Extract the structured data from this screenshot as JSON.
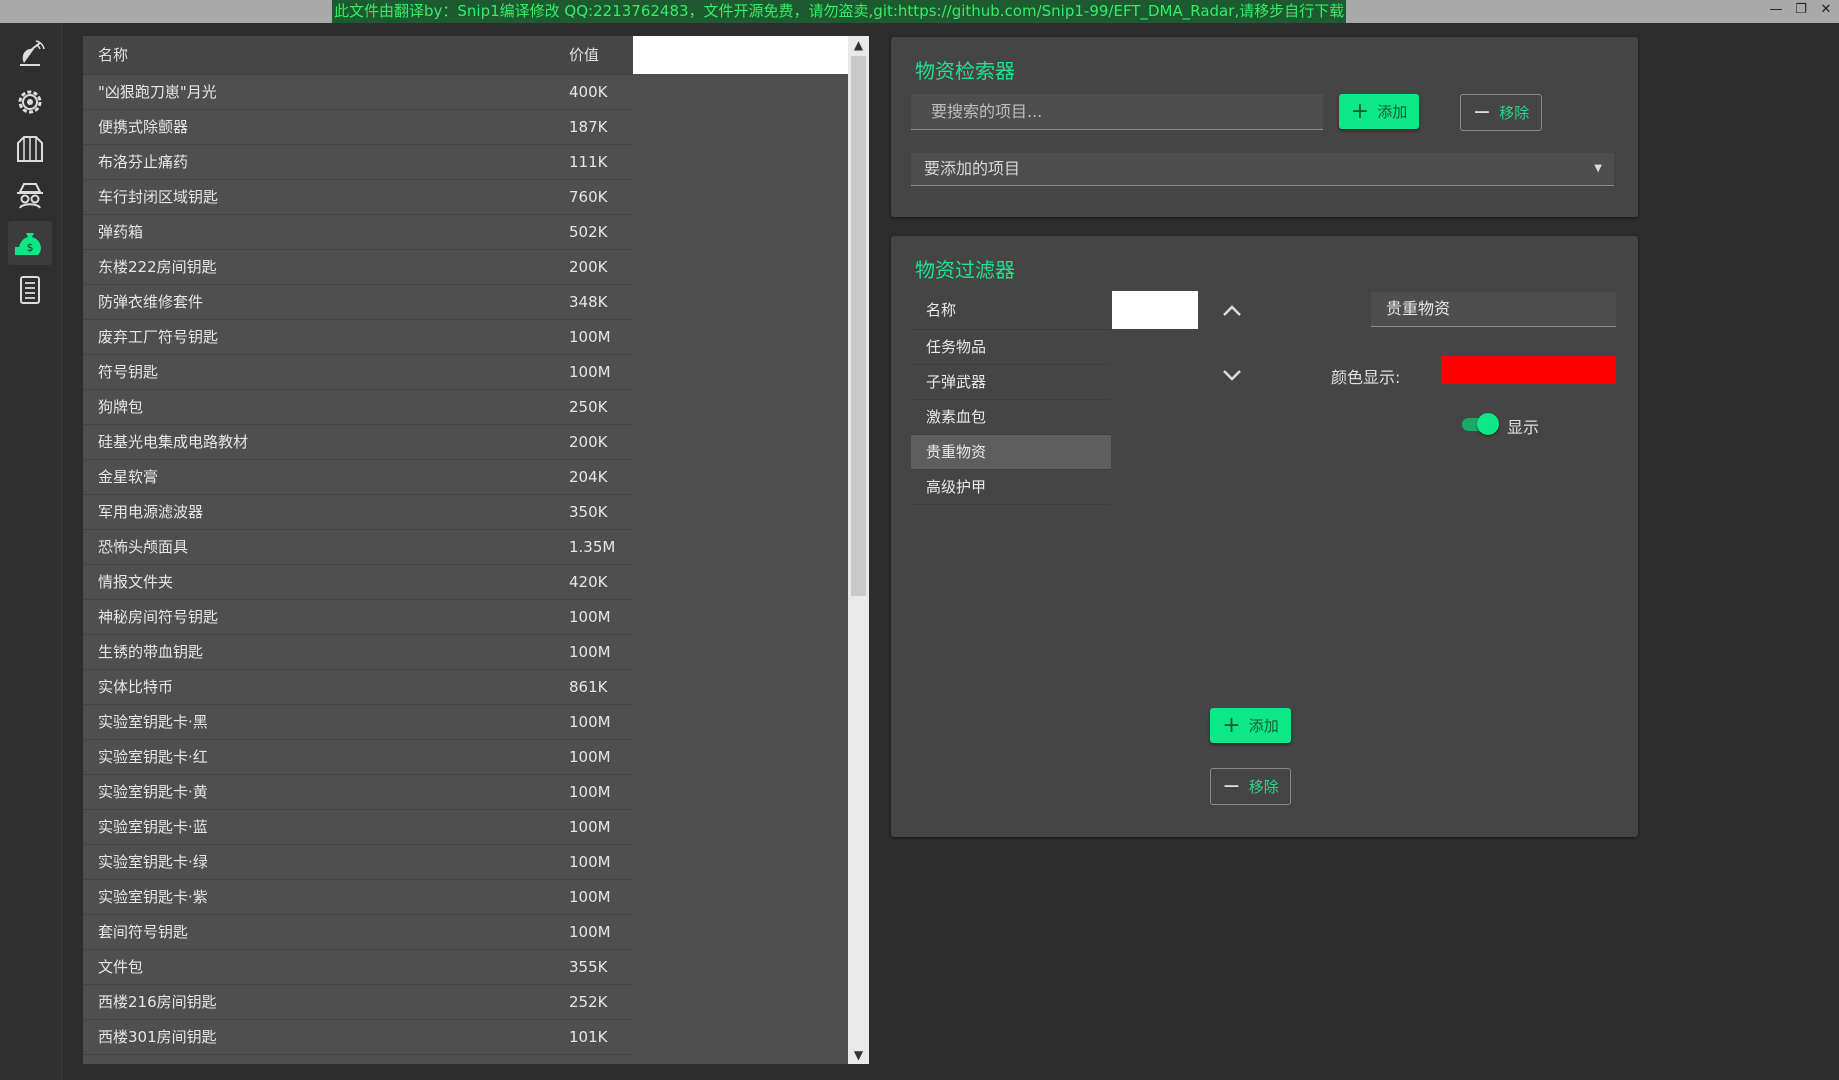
{
  "titlebar": {
    "banner": "此文件由翻译by：Snip1编译修改 QQ:2213762483，文件开源免费，请勿盗卖,git:https://github.com/Snip1-99/EFT_DMA_Radar,请移步自行下载",
    "minimize": "—",
    "restore": "❐",
    "close": "✕"
  },
  "sidebar": {
    "items": [
      {
        "icon": "radar-icon"
      },
      {
        "icon": "settings-gear-icon"
      },
      {
        "icon": "jacket-icon"
      },
      {
        "icon": "spy-icon"
      },
      {
        "icon": "money-bag-icon",
        "active": true
      },
      {
        "icon": "document-list-icon"
      }
    ]
  },
  "loot_table": {
    "headers": {
      "name": "名称",
      "value": "价值"
    },
    "rows": [
      {
        "name": "\"凶狠跑刀崽\"月光",
        "value": "400K"
      },
      {
        "name": "便携式除颤器",
        "value": "187K"
      },
      {
        "name": "布洛芬止痛药",
        "value": "111K"
      },
      {
        "name": "车行封闭区域钥匙",
        "value": "760K"
      },
      {
        "name": "弹药箱",
        "value": "502K"
      },
      {
        "name": "东楼222房间钥匙",
        "value": "200K"
      },
      {
        "name": "防弹衣维修套件",
        "value": "348K"
      },
      {
        "name": "废弃工厂符号钥匙",
        "value": "100M"
      },
      {
        "name": "符号钥匙",
        "value": "100M"
      },
      {
        "name": "狗牌包",
        "value": "250K"
      },
      {
        "name": "硅基光电集成电路教材",
        "value": "200K"
      },
      {
        "name": "金星软膏",
        "value": "204K"
      },
      {
        "name": "军用电源滤波器",
        "value": "350K"
      },
      {
        "name": "恐怖头颅面具",
        "value": "1.35M"
      },
      {
        "name": "情报文件夹",
        "value": "420K"
      },
      {
        "name": "神秘房间符号钥匙",
        "value": "100M"
      },
      {
        "name": "生锈的带血钥匙",
        "value": "100M"
      },
      {
        "name": "实体比特币",
        "value": "861K"
      },
      {
        "name": "实验室钥匙卡·黑",
        "value": "100M"
      },
      {
        "name": "实验室钥匙卡·红",
        "value": "100M"
      },
      {
        "name": "实验室钥匙卡·黄",
        "value": "100M"
      },
      {
        "name": "实验室钥匙卡·蓝",
        "value": "100M"
      },
      {
        "name": "实验室钥匙卡·绿",
        "value": "100M"
      },
      {
        "name": "实验室钥匙卡·紫",
        "value": "100M"
      },
      {
        "name": "套间符号钥匙",
        "value": "100M"
      },
      {
        "name": "文件包",
        "value": "355K"
      },
      {
        "name": "西楼216房间钥匙",
        "value": "252K"
      },
      {
        "name": "西楼301房间钥匙",
        "value": "101K"
      }
    ]
  },
  "search_card": {
    "title": "物资检索器",
    "search_placeholder": "要搜索的项目...",
    "add_label": "添加",
    "remove_label": "移除",
    "dropdown_value": "要添加的项目"
  },
  "filter_card": {
    "title": "物资过滤器",
    "list_header": "名称",
    "items": [
      "任务物品",
      "子弹武器",
      "激素血包",
      "贵重物资",
      "高级护甲"
    ],
    "selected_index": 3,
    "name_value": "贵重物资",
    "color_label": "颜色显示:",
    "color_value": "#ff0000",
    "toggle_label": "显示",
    "toggle_on": true,
    "add_label": "添加",
    "remove_label": "移除"
  },
  "colors": {
    "accent": "#0be885",
    "panel": "#454545",
    "background": "#2d2d2d"
  }
}
